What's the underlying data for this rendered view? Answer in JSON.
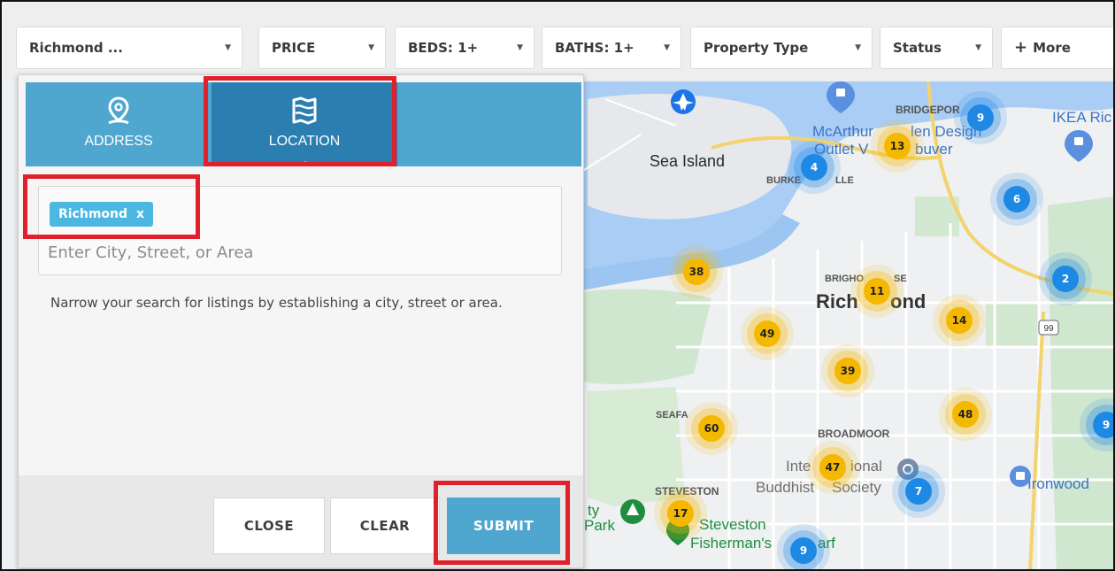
{
  "filters": {
    "location_label": "Richmond ...",
    "price_label": "PRICE",
    "beds_label": "BEDS: 1+",
    "baths_label": "BATHS: 1+",
    "property_type_label": "Property Type",
    "status_label": "Status",
    "more_label": "More"
  },
  "panel": {
    "tabs": [
      {
        "label": "ADDRESS",
        "icon": "map-pin-icon"
      },
      {
        "label": "LOCATION",
        "icon": "map-area-icon",
        "active": true
      }
    ],
    "chip_label": "Richmond",
    "chip_remove": "x",
    "input_placeholder": "Enter City, Street, or Area",
    "help_text": "Narrow your search for listings by establishing a city, street or area.",
    "buttons": {
      "close": "CLOSE",
      "clear": "CLEAR",
      "submit": "SUBMIT"
    }
  },
  "map": {
    "labels": {
      "sea_island": "Sea Island",
      "burkeville": "BURKE",
      "burkeville_tail": "LLE",
      "bridgeport": "BRIDGEPOR",
      "mcarthur_1": "McArthur",
      "mcarthur_2": "len Design",
      "outlet_1": "Outlet V",
      "outlet_2": "buver",
      "ikea": "IKEA Ric",
      "brighouse": "BRIGHO",
      "brighouse_tail": "SE",
      "richmond_1": "Rich",
      "richmond_2": "ond",
      "seafair": "SEAFA",
      "broadmoor": "BROADMOOR",
      "intl_1": "Inte",
      "intl_2": "ional",
      "buddhist_1": "Buddhist",
      "buddhist_2": "Society",
      "steveston": "STEVESTON",
      "steveston_town": "Steveston",
      "fisherman_1": "Fisherman's",
      "fisherman_2": "arf",
      "park_1": "ty",
      "park_2": "Park",
      "ironwood": "Ironwood",
      "highway": "99"
    },
    "clusters": [
      {
        "count": "9",
        "color": "#1e88e5"
      },
      {
        "count": "13",
        "color": "#f5b800"
      },
      {
        "count": "4",
        "color": "#1e88e5"
      },
      {
        "count": "6",
        "color": "#1e88e5"
      },
      {
        "count": "2",
        "color": "#1e88e5"
      },
      {
        "count": "38",
        "color": "#f5b800"
      },
      {
        "count": "11",
        "color": "#f5b800"
      },
      {
        "count": "14",
        "color": "#f5b800"
      },
      {
        "count": "49",
        "color": "#f5b800"
      },
      {
        "count": "39",
        "color": "#f5b800"
      },
      {
        "count": "48",
        "color": "#f5b800"
      },
      {
        "count": "60",
        "color": "#f5b800"
      },
      {
        "count": "47",
        "color": "#f5b800"
      },
      {
        "count": "7",
        "color": "#1e88e5"
      },
      {
        "count": "17",
        "color": "#f5b800"
      },
      {
        "count": "9",
        "color": "#1e88e5"
      },
      {
        "count": "9",
        "color": "#1e88e5"
      }
    ]
  },
  "colors": {
    "accent": "#4fa6cf",
    "active_tab": "#2a7fb0",
    "chip": "#4cb8e2",
    "highlight": "#e0202a",
    "cluster_yellow": "#f5b800",
    "cluster_blue": "#1e88e5"
  }
}
